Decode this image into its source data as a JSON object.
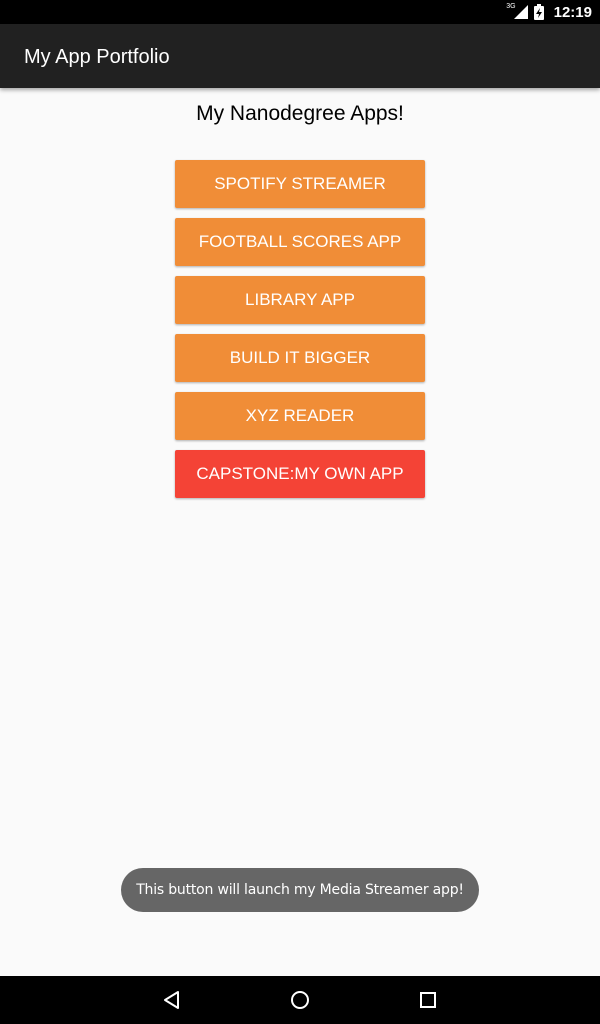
{
  "status_bar": {
    "network_type": "3G",
    "time": "12:19"
  },
  "app_bar": {
    "title": "My App Portfolio"
  },
  "main": {
    "heading": "My Nanodegree Apps!",
    "buttons": [
      {
        "label": "SPOTIFY STREAMER",
        "color": "#F08D37"
      },
      {
        "label": "FOOTBALL SCORES APP",
        "color": "#F08D37"
      },
      {
        "label": "LIBRARY APP",
        "color": "#F08D37"
      },
      {
        "label": "BUILD IT BIGGER",
        "color": "#F08D37"
      },
      {
        "label": "XYZ READER",
        "color": "#F08D37"
      },
      {
        "label": "CAPSTONE:MY OWN APP",
        "color": "#F44336"
      }
    ]
  },
  "toast": {
    "message": "This button will launch my Media Streamer app!"
  },
  "nav_bar": {
    "icons": [
      "back-icon",
      "home-icon",
      "recents-icon"
    ]
  }
}
